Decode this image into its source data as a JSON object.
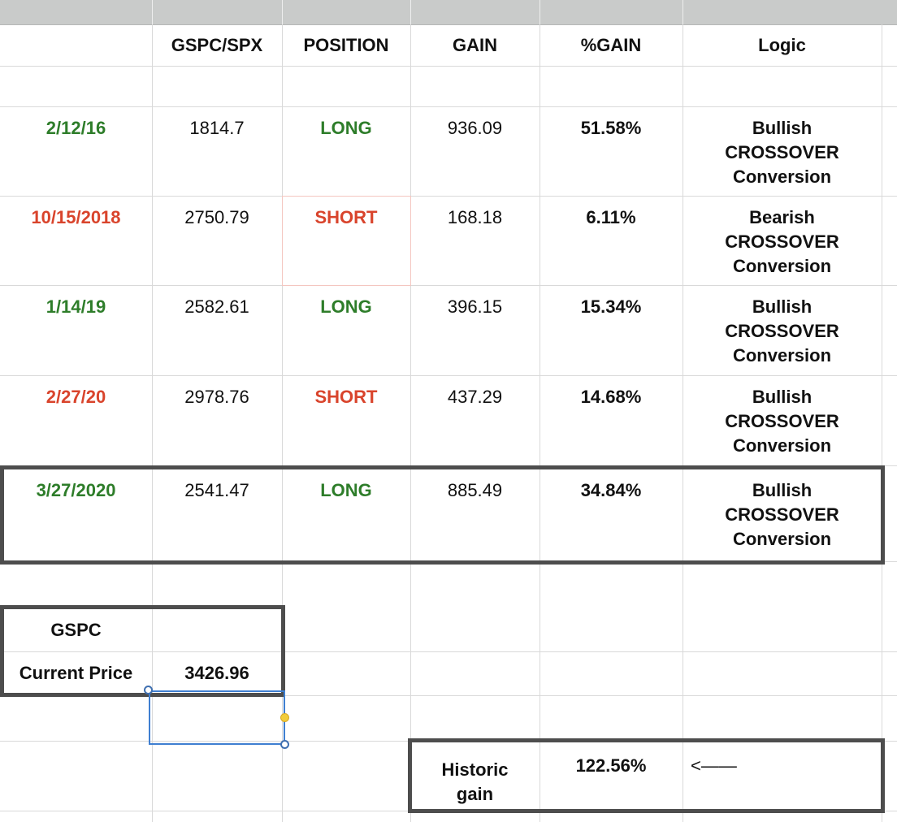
{
  "headers": [
    "",
    "GSPC/SPX",
    "POSITION",
    "GAIN",
    "%GAIN",
    "Logic"
  ],
  "rows": [
    {
      "date": "2/12/16",
      "price": "1814.7",
      "position": "LONG",
      "gain": "936.09",
      "pct": "51.58%",
      "logic": [
        "Bullish",
        "CROSSOVER",
        "Conversion"
      ]
    },
    {
      "date": "10/15/2018",
      "price": "2750.79",
      "position": "SHORT",
      "gain": "168.18",
      "pct": "6.11%",
      "logic": [
        "Bearish",
        "CROSSOVER",
        "Conversion"
      ]
    },
    {
      "date": "1/14/19",
      "price": "2582.61",
      "position": "LONG",
      "gain": "396.15",
      "pct": "15.34%",
      "logic": [
        "Bullish",
        "CROSSOVER",
        "Conversion"
      ]
    },
    {
      "date": "2/27/20",
      "price": "2978.76",
      "position": "SHORT",
      "gain": "437.29",
      "pct": "14.68%",
      "logic": [
        "Bullish",
        "CROSSOVER",
        "Conversion"
      ]
    },
    {
      "date": "3/27/2020",
      "price": "2541.47",
      "position": "LONG",
      "gain": "885.49",
      "pct": "34.84%",
      "logic": [
        "Bullish",
        "CROSSOVER",
        "Conversion"
      ]
    }
  ],
  "current": {
    "ticker": "GSPC",
    "label": "Current Price",
    "value": "3426.96"
  },
  "historic": {
    "label": "Historic gain",
    "value": "122.56%",
    "arrow": "<——"
  },
  "colors": {
    "long": "#2e7d2a",
    "short": "#d9442c",
    "border": "#4d4d4d",
    "selection": "#3f7fd1"
  }
}
